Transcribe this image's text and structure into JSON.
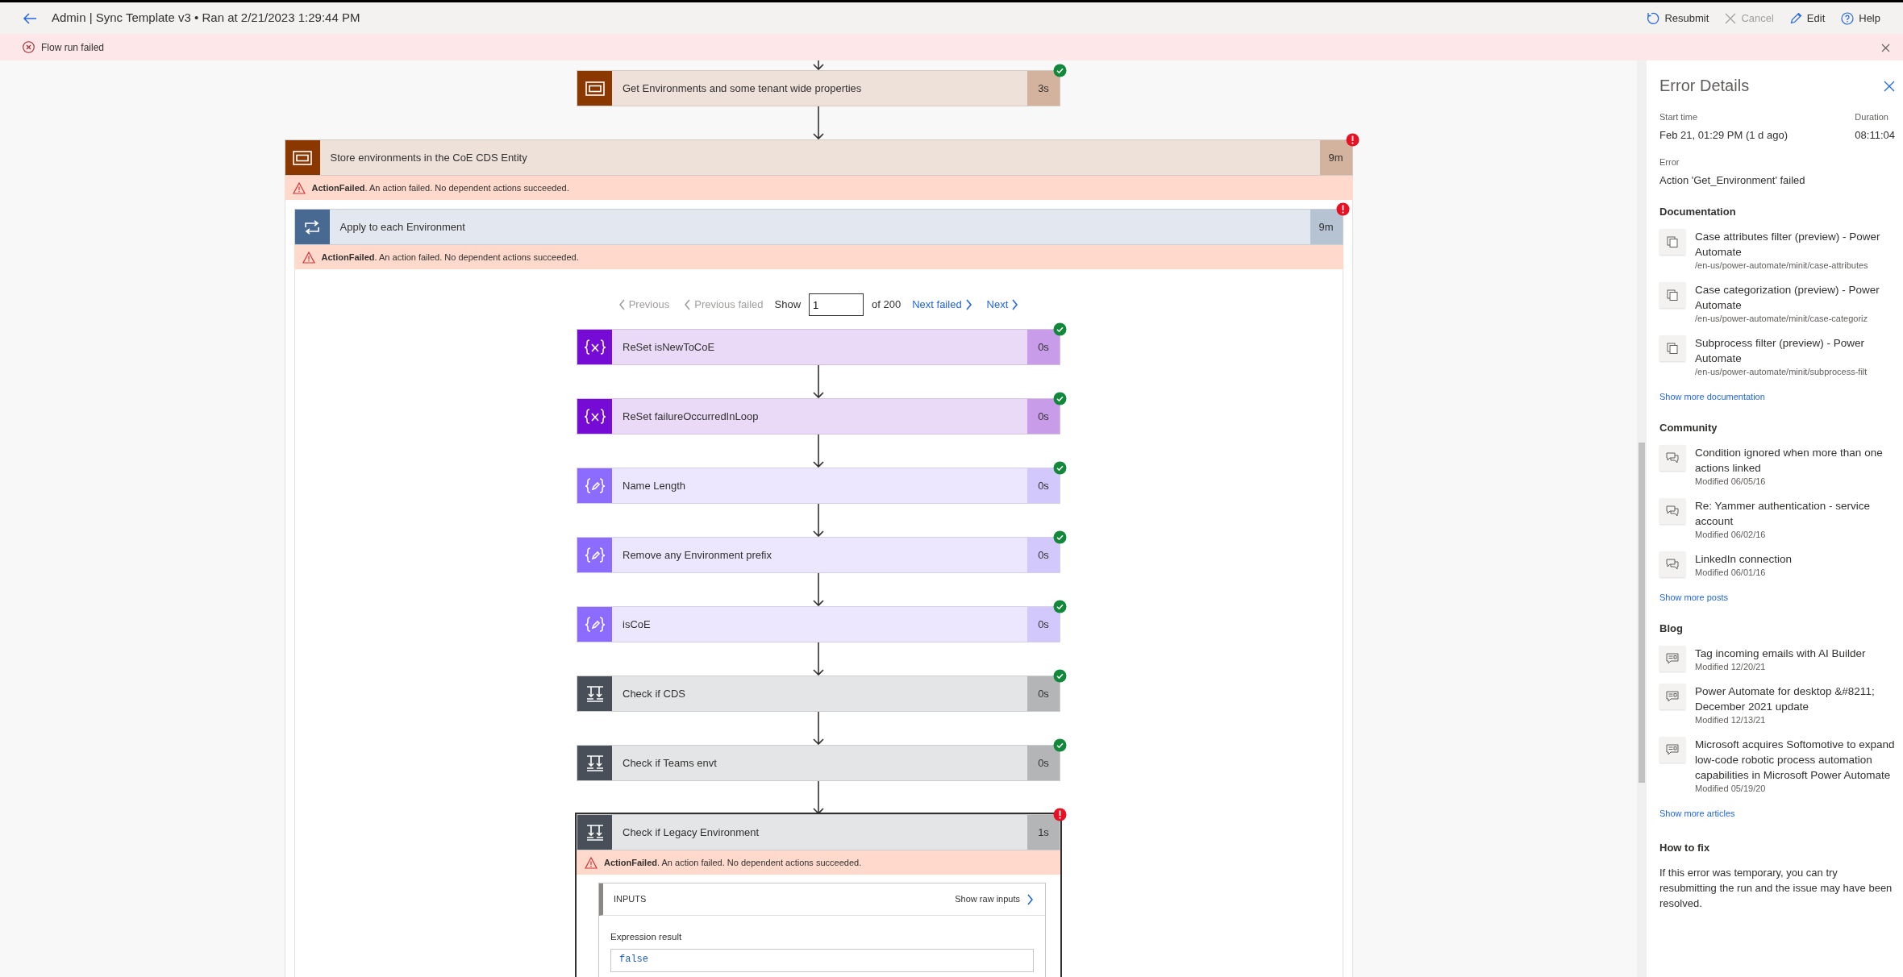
{
  "header": {
    "title": "Admin | Sync Template v3 • Ran at 2/21/2023 1:29:44 PM",
    "actions": [
      {
        "label": "Resubmit",
        "kind": "resubmit",
        "disabled": false
      },
      {
        "label": "Cancel",
        "kind": "cancel",
        "disabled": true
      },
      {
        "label": "Edit",
        "kind": "edit",
        "disabled": false
      },
      {
        "label": "Help",
        "kind": "help",
        "disabled": false
      }
    ]
  },
  "banner": {
    "message": "Flow run failed"
  },
  "flow": [
    {
      "kind": "scope",
      "title": "Get Environments and some tenant wide properties",
      "duration": "3s",
      "failed": false,
      "selected": false
    },
    {
      "kind": "scope",
      "title": "Store environments in the CoE CDS Entity",
      "duration": "9m",
      "failed": true,
      "selected": false,
      "error": "**ActionFailed**. An action failed. No dependent actions succeeded.",
      "children": [
        {
          "kind": "foreach",
          "title": "Apply to each Environment",
          "duration": "9m",
          "failed": true,
          "selected": false,
          "error": "**ActionFailed**. An action failed. No dependent actions succeeded.",
          "pager": {
            "before": [
              {
                "label": "Previous",
                "disabled": true
              },
              {
                "label": "Previous failed",
                "disabled": true
              }
            ],
            "show": "Show",
            "value": "1",
            "total": "of 200",
            "after": [
              {
                "label": "Next failed",
                "disabled": false
              },
              {
                "label": "Next",
                "disabled": false
              }
            ]
          },
          "children": [
            {
              "kind": "variable",
              "title": "ReSet isNewToCoE",
              "duration": "0s",
              "failed": false,
              "selected": false
            },
            {
              "kind": "variable",
              "title": "ReSet failureOccurredInLoop",
              "duration": "0s",
              "failed": false,
              "selected": false
            },
            {
              "kind": "compose",
              "title": "Name Length",
              "duration": "0s",
              "failed": false,
              "selected": false
            },
            {
              "kind": "compose",
              "title": "Remove any Environment prefix",
              "duration": "0s",
              "failed": false,
              "selected": false
            },
            {
              "kind": "compose",
              "title": "isCoE",
              "duration": "0s",
              "failed": false,
              "selected": false
            },
            {
              "kind": "condition",
              "title": "Check if CDS",
              "duration": "0s",
              "failed": false,
              "selected": false
            },
            {
              "kind": "condition",
              "title": "Check if Teams envt",
              "duration": "0s",
              "failed": false,
              "selected": false
            },
            {
              "kind": "condition",
              "title": "Check if Legacy Environment",
              "duration": "1s",
              "failed": true,
              "selected": true,
              "error": "**ActionFailed**. An action failed. No dependent actions succeeded.",
              "inputs": {
                "title": "INPUTS",
                "raw_link": "Show raw inputs",
                "fields": [
                  {
                    "label": "Expression result",
                    "value": "false"
                  }
                ]
              }
            }
          ]
        }
      ]
    }
  ],
  "panel": {
    "title": "Error Details",
    "start_label": "Start time",
    "start": "Feb 21, 01:29 PM (1 d ago)",
    "duration_label": "Duration",
    "duration": "08:11:04",
    "error_label": "Error",
    "error": "Action 'Get_Environment' failed",
    "sections": [
      {
        "heading": "Documentation",
        "kind": "doc",
        "more": "Show more documentation",
        "items": [
          {
            "title": "Case attributes filter (preview) - Power Automate",
            "subtitle": "/en-us/power-automate/minit/case-attributes"
          },
          {
            "title": "Case categorization (preview) - Power Automate",
            "subtitle": "/en-us/power-automate/minit/case-categoriz"
          },
          {
            "title": "Subprocess filter (preview) - Power Automate",
            "subtitle": "/en-us/power-automate/minit/subprocess-filt"
          }
        ]
      },
      {
        "heading": "Community",
        "kind": "post",
        "more": "Show more posts",
        "items": [
          {
            "title": "Condition ignored when more than one actions linked",
            "subtitle": "Modified 06/05/16"
          },
          {
            "title": "Re: Yammer authentication - service account",
            "subtitle": "Modified 06/02/16"
          },
          {
            "title": "LinkedIn connection",
            "subtitle": "Modified 06/01/16"
          }
        ]
      },
      {
        "heading": "Blog",
        "kind": "article",
        "more": "Show more articles",
        "items": [
          {
            "title": "Tag incoming emails with AI Builder",
            "subtitle": "Modified 12/20/21"
          },
          {
            "title": "Power Automate for desktop &#8211; December 2021 update",
            "subtitle": "Modified 12/13/21"
          },
          {
            "title": "Microsoft acquires Softomotive to expand low-code robotic process automation capabilities in Microsoft Power Automate",
            "subtitle": "Modified 05/19/20"
          }
        ]
      }
    ],
    "fix": {
      "heading": "How to fix",
      "text": "If this error was temporary, you can try resubmitting the run and the issue may have been resolved."
    }
  }
}
